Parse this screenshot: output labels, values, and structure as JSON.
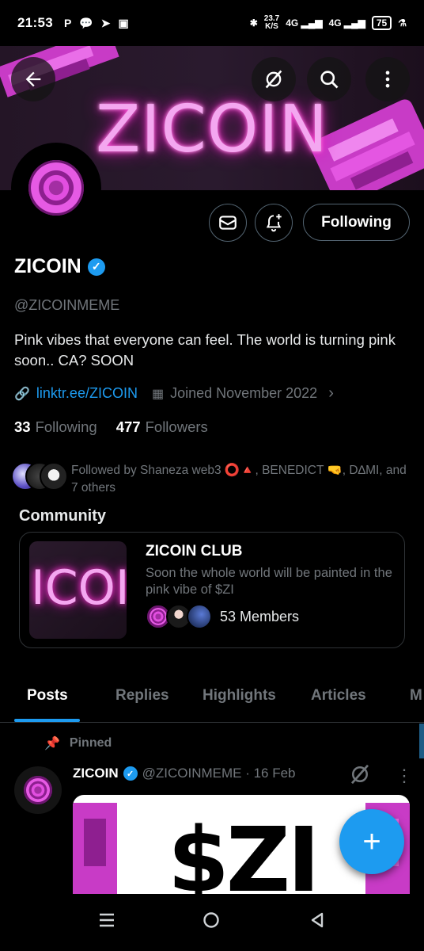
{
  "status_bar": {
    "time": "21:53",
    "left_icons": [
      "P",
      "chat-icon",
      "telegram-icon",
      "gallery-icon"
    ],
    "speed_value": "23.7",
    "speed_unit": "K/S",
    "network1": "4G",
    "network2": "4G",
    "battery": "75"
  },
  "banner": {
    "title": "ZICOIN",
    "accent": "#ff3ad2"
  },
  "actions": {
    "following_label": "Following"
  },
  "profile": {
    "name": "ZICOIN",
    "handle": "@ZICOINMEME",
    "bio": "Pink vibes that everyone can feel.   The world is turning pink soon..  CA? SOON",
    "link": "linktr.ee/ZICOIN",
    "joined": "Joined November 2022",
    "following_count": "33",
    "following_label": "Following",
    "followers_count": "477",
    "followers_label": "Followers",
    "followed_by": "Followed by Shaneza web3 ⭕🔺, BENEDICT 🤜, D∆MI, and 7 others"
  },
  "community": {
    "section_label": "Community",
    "thumb_text": "ICOIN",
    "title": "ZICOIN CLUB",
    "description": "Soon the whole world will be painted in the pink vibe of $ZI",
    "members": "53 Members"
  },
  "tabs": [
    {
      "label": "Posts"
    },
    {
      "label": "Replies"
    },
    {
      "label": "Highlights"
    },
    {
      "label": "Articles"
    },
    {
      "label": "M"
    }
  ],
  "post": {
    "pinned_label": "Pinned",
    "name": "ZICOIN",
    "handle_date": "@ZICOINMEME · 16 Feb",
    "image_text": "$ZI"
  },
  "fab_label": "+"
}
